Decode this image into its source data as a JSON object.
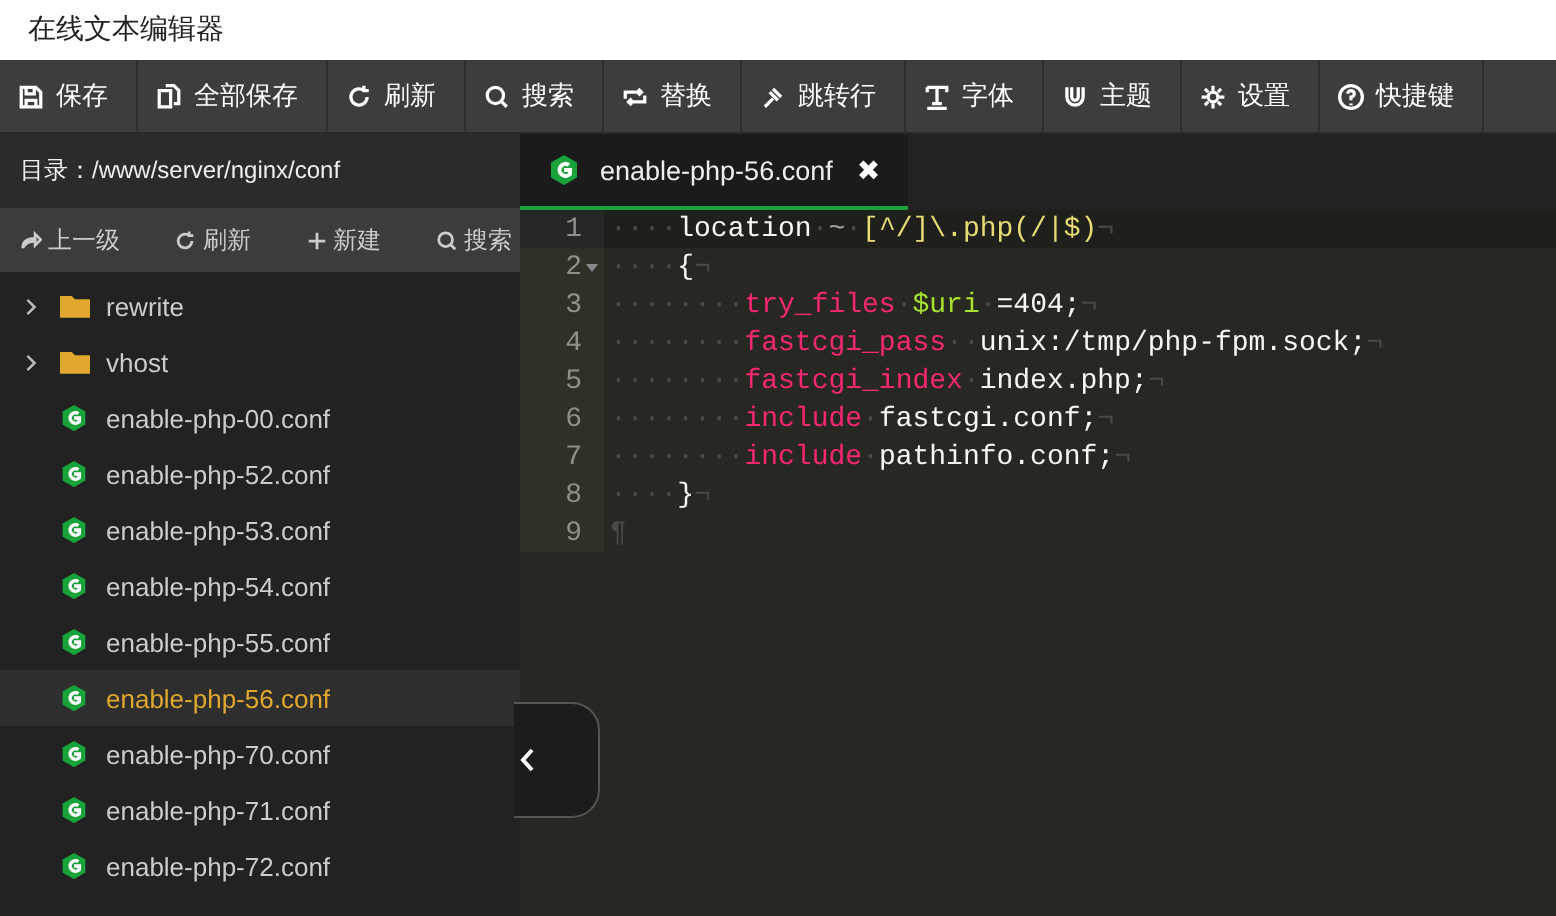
{
  "window": {
    "title": "在线文本编辑器"
  },
  "toolbar": [
    {
      "label": "保存"
    },
    {
      "label": "全部保存"
    },
    {
      "label": "刷新"
    },
    {
      "label": "搜索"
    },
    {
      "label": "替换"
    },
    {
      "label": "跳转行"
    },
    {
      "label": "字体"
    },
    {
      "label": "主题"
    },
    {
      "label": "设置"
    },
    {
      "label": "快捷键"
    }
  ],
  "sidebar": {
    "path_label": "目录：",
    "path": "/www/server/nginx/conf",
    "actions": [
      {
        "label": "上一级"
      },
      {
        "label": "刷新"
      },
      {
        "label": "新建"
      },
      {
        "label": "搜索"
      }
    ],
    "items": [
      {
        "kind": "folder",
        "name": "rewrite",
        "expanded": false,
        "selected": false
      },
      {
        "kind": "folder",
        "name": "vhost",
        "expanded": false,
        "selected": false
      },
      {
        "kind": "file",
        "name": "enable-php-00.conf",
        "selected": false
      },
      {
        "kind": "file",
        "name": "enable-php-52.conf",
        "selected": false
      },
      {
        "kind": "file",
        "name": "enable-php-53.conf",
        "selected": false
      },
      {
        "kind": "file",
        "name": "enable-php-54.conf",
        "selected": false
      },
      {
        "kind": "file",
        "name": "enable-php-55.conf",
        "selected": false
      },
      {
        "kind": "file",
        "name": "enable-php-56.conf",
        "selected": true
      },
      {
        "kind": "file",
        "name": "enable-php-70.conf",
        "selected": false
      },
      {
        "kind": "file",
        "name": "enable-php-71.conf",
        "selected": false
      },
      {
        "kind": "file",
        "name": "enable-php-72.conf",
        "selected": false
      }
    ]
  },
  "tabs": [
    {
      "label": "enable-php-56.conf",
      "selected": true,
      "close": "✖"
    }
  ],
  "editor": {
    "lines": [
      {
        "number": "1",
        "active": true,
        "fold_open": false,
        "tokens": [
          {
            "kind": "ws",
            "text": "····"
          },
          {
            "kind": "plain",
            "text": "location"
          },
          {
            "kind": "ws",
            "text": "·"
          },
          {
            "kind": "op",
            "text": "~"
          },
          {
            "kind": "ws",
            "text": "·"
          },
          {
            "kind": "string",
            "text": "[^/]\\.php(/|$)"
          },
          {
            "kind": "ws",
            "text": "¬"
          }
        ]
      },
      {
        "number": "2",
        "active": false,
        "fold_open": true,
        "tokens": [
          {
            "kind": "ws",
            "text": "····"
          },
          {
            "kind": "plain",
            "text": "{"
          },
          {
            "kind": "ws",
            "text": "¬"
          }
        ]
      },
      {
        "number": "3",
        "active": false,
        "fold_open": false,
        "tokens": [
          {
            "kind": "ws",
            "text": "········"
          },
          {
            "kind": "keyword",
            "text": "try_files"
          },
          {
            "kind": "ws",
            "text": "·"
          },
          {
            "kind": "variable",
            "text": "$uri"
          },
          {
            "kind": "ws",
            "text": "·"
          },
          {
            "kind": "plain",
            "text": "=404;"
          },
          {
            "kind": "ws",
            "text": "¬"
          }
        ]
      },
      {
        "number": "4",
        "active": false,
        "fold_open": false,
        "tokens": [
          {
            "kind": "ws",
            "text": "········"
          },
          {
            "kind": "keyword",
            "text": "fastcgi_pass"
          },
          {
            "kind": "ws",
            "text": "··"
          },
          {
            "kind": "plain",
            "text": "unix:/tmp/php-fpm.sock;"
          },
          {
            "kind": "ws",
            "text": "¬"
          }
        ]
      },
      {
        "number": "5",
        "active": false,
        "fold_open": false,
        "tokens": [
          {
            "kind": "ws",
            "text": "········"
          },
          {
            "kind": "keyword",
            "text": "fastcgi_index"
          },
          {
            "kind": "ws",
            "text": "·"
          },
          {
            "kind": "plain",
            "text": "index.php;"
          },
          {
            "kind": "ws",
            "text": "¬"
          }
        ]
      },
      {
        "number": "6",
        "active": false,
        "fold_open": false,
        "tokens": [
          {
            "kind": "ws",
            "text": "········"
          },
          {
            "kind": "keyword",
            "text": "include"
          },
          {
            "kind": "ws",
            "text": "·"
          },
          {
            "kind": "plain",
            "text": "fastcgi.conf;"
          },
          {
            "kind": "ws",
            "text": "¬"
          }
        ]
      },
      {
        "number": "7",
        "active": false,
        "fold_open": false,
        "tokens": [
          {
            "kind": "ws",
            "text": "········"
          },
          {
            "kind": "keyword",
            "text": "include"
          },
          {
            "kind": "ws",
            "text": "·"
          },
          {
            "kind": "plain",
            "text": "pathinfo.conf;"
          },
          {
            "kind": "ws",
            "text": "¬"
          }
        ]
      },
      {
        "number": "8",
        "active": false,
        "fold_open": false,
        "tokens": [
          {
            "kind": "ws",
            "text": "····"
          },
          {
            "kind": "plain",
            "text": "}"
          },
          {
            "kind": "ws",
            "text": "¬"
          }
        ]
      },
      {
        "number": "9",
        "active": false,
        "fold_open": false,
        "tokens": [
          {
            "kind": "ws",
            "text": "¶"
          }
        ]
      }
    ]
  }
}
